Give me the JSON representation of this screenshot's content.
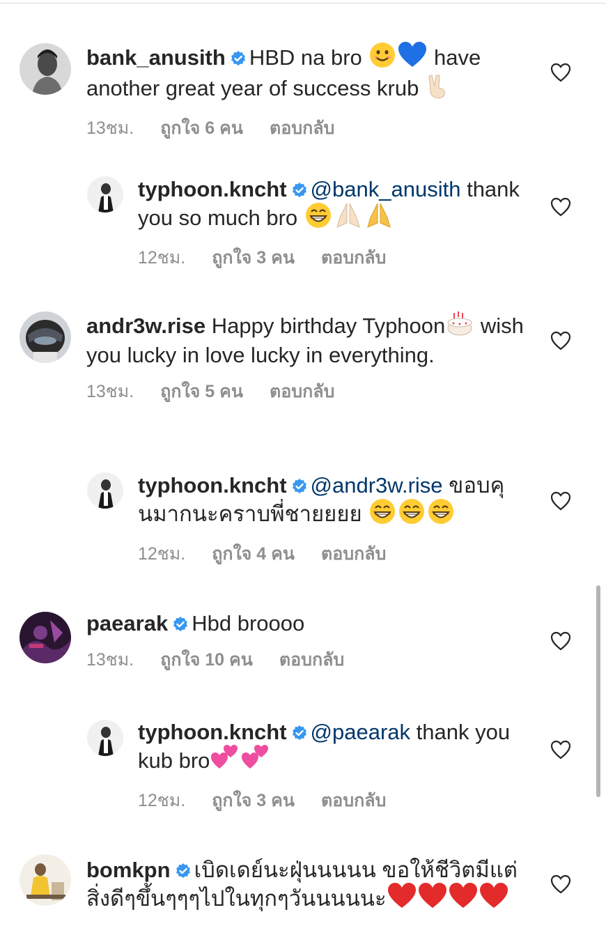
{
  "comments": [
    {
      "username": "bank_anusith",
      "verified": true,
      "text": "HBD na bro",
      "emojis_inline": [
        "😊",
        "💙"
      ],
      "text2": "have another great year of success krub",
      "emoji_end": "✌🏻",
      "time": "13ชม.",
      "likes": "ถูกใจ 6 คน",
      "reply": "ตอบกลับ"
    },
    {
      "username": "typhoon.kncht",
      "verified": true,
      "mention": "@bank_anusith",
      "text": "thank you so much bro",
      "emojis": [
        "😁",
        "🙏🏻",
        "🙏"
      ],
      "time": "12ชม.",
      "likes": "ถูกใจ 3 คน",
      "reply": "ตอบกลับ"
    },
    {
      "username": "andr3w.rise",
      "verified": false,
      "text": "Happy birthday Typhoon",
      "emoji_end": "🎂",
      "text2": "wish you lucky in love lucky in everything.",
      "time": "13ชม.",
      "likes": "ถูกใจ 5 คน",
      "reply": "ตอบกลับ"
    },
    {
      "username": "typhoon.kncht",
      "verified": true,
      "mention": "@andr3w.rise",
      "text": "ขอบคุนมากนะคราบพี่ชายยยย",
      "emojis": [
        "😁",
        "😁",
        "😁"
      ],
      "time": "12ชม.",
      "likes": "ถูกใจ 4 คน",
      "reply": "ตอบกลับ"
    },
    {
      "username": "paearak",
      "verified": true,
      "text": "Hbd broooo",
      "time": "13ชม.",
      "likes": "ถูกใจ 10 คน",
      "reply": "ตอบกลับ"
    },
    {
      "username": "typhoon.kncht",
      "verified": true,
      "mention": "@paearak",
      "text": "thank you kub bro",
      "emojis": [
        "💕",
        "💕"
      ],
      "time": "12ชม.",
      "likes": "ถูกใจ 3 คน",
      "reply": "ตอบกลับ"
    },
    {
      "username": "bomkpn",
      "verified": true,
      "text": "เบิดเดย์นะฝุ่นนนนน ขอให้ชีวิตมีแต่สิ่งดีๆขึ้นๆๆๆไปในทุกๆวันนนนนะ",
      "emojis": [
        "❤️",
        "❤️",
        "❤️",
        "❤️"
      ]
    }
  ],
  "icons": {
    "verified": "verified-badge-icon",
    "heart": "heart-outline-icon"
  },
  "colors": {
    "verified": "#3897f0",
    "mention": "#00376b",
    "meta": "#8e8e8e",
    "text": "#262626"
  }
}
